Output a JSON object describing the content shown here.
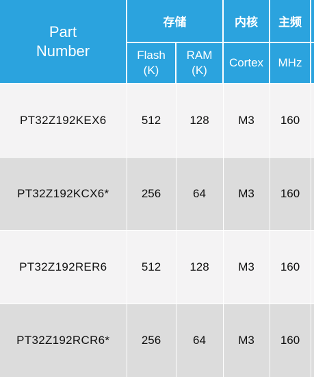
{
  "header": {
    "part_number": "Part\nNumber",
    "groups": {
      "storage": "存储",
      "core": "内核",
      "main_freq": "主频"
    },
    "sub": {
      "flash": "Flash\n(K)",
      "ram": "RAM\n(K)",
      "cortex": "Cortex",
      "mhz": "MHz"
    }
  },
  "rows": [
    {
      "part": "PT32Z192KEX6",
      "flash": "512",
      "ram": "128",
      "core": "M3",
      "mhz": "160"
    },
    {
      "part": "PT32Z192KCX6*",
      "flash": "256",
      "ram": "64",
      "core": "M3",
      "mhz": "160"
    },
    {
      "part": "PT32Z192RER6",
      "flash": "512",
      "ram": "128",
      "core": "M3",
      "mhz": "160"
    },
    {
      "part": "PT32Z192RCR6*",
      "flash": "256",
      "ram": "64",
      "core": "M3",
      "mhz": "160"
    }
  ],
  "colors": {
    "header_bg": "#2ba3de",
    "row_light": "#f4f3f4",
    "row_dark": "#dcdcdc"
  }
}
